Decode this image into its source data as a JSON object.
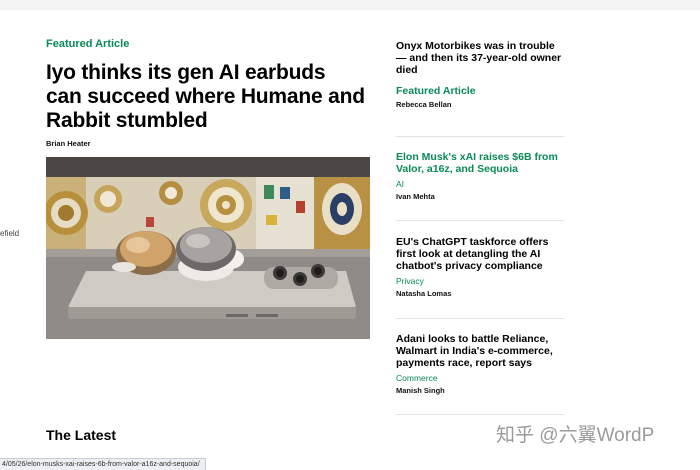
{
  "left_fragment": "efield",
  "featured": {
    "tag": "Featured Article",
    "headline": "Iyo thinks its gen AI earbuds can succeed where Humane and Rabbit stumbled",
    "author": "Brian Heater",
    "image_description_icon": "earbuds-photo"
  },
  "sidebar": [
    {
      "title": "Onyx Motorbikes was in trouble — and then its 37-year-old owner died",
      "category": "Featured Article",
      "author": "Rebecca Bellan"
    },
    {
      "title": "Elon Musk's xAI raises $6B from Valor, a16z, and Sequoia",
      "category": "AI",
      "author": "Ivan Mehta"
    },
    {
      "title": "EU's ChatGPT taskforce offers first look at detangling the AI chatbot's privacy compliance",
      "category": "Privacy",
      "author": "Natasha Lomas"
    },
    {
      "title": "Adani looks to battle Reliance, Walmart in India's e-commerce, payments race, report says",
      "category": "Commerce",
      "author": "Manish Singh"
    }
  ],
  "latest_heading": "The Latest",
  "watermark": "知乎 @六翼WordP",
  "status_url": "4/05/26/elon-musks-xai-raises-6b-from-valor-a16z-and-sequoia/",
  "colors": {
    "accent_green": "#0a8a55",
    "text": "#000000",
    "separator": "#e2e2e2"
  }
}
